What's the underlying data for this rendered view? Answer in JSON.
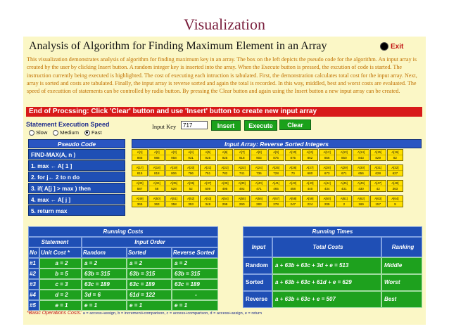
{
  "slide_title": "Visualization",
  "app": {
    "title": "Analysis of Algorithm for Finding Maximum Element in an Array",
    "exit_label": "Exit",
    "description": "This visualization demonstrates analysis of algorithm for finding maximum key in an array. The box on the left depicts the pseudo code for the algorithm. An input array is created by the user by clicking Insert button. A random integer key is inserted into the array. When the Execute button is pressed, the excution of code is started. The instruction currently being executed is highlighted. The cost of executing each intruction is tabulated. First, the demonstration calculates total cost for the input array. Next, array is sorted and costs are tabulated. Finally, the input array is reverse sorted and again the total is recorded. In this way, middled, best and worst costs are evaluated. The speed of executtion of statements can be controlled by radio button. By pressing the Clear button and again using the Insert button a new input array can be created.",
    "status_message": "End of Procssing: Click 'Clear' button and use 'Insert' button to create new input array"
  },
  "controls": {
    "speed_label": "Statement Execution Speed",
    "speed_options": [
      "Slow",
      "Medium",
      "Fast"
    ],
    "selected_speed": "Fast",
    "input_key_label": "Input Key",
    "input_key_value": "717",
    "insert_label": "Insert",
    "execute_label": "Execute",
    "clear_label": "Clear"
  },
  "pseudo_code": {
    "header": "Pseudo Code",
    "lines": [
      "FIND-MAX(A, n )",
      "1.  max ← A[ 1 ]",
      "2.  for j← 2 to n do",
      "3.      if( A[j ] > max ) then",
      "4.       max ← A[ j ]",
      "5.  return max"
    ]
  },
  "input_array": {
    "header": "Input Array: Reverse Sorted Integers",
    "rows": [
      {
        "indices": [
          "A[1]",
          "A[2]",
          "A[3]",
          "A[4]",
          "A[5]",
          "A[6]",
          "A[7]",
          "A[8]",
          "A[9]",
          "A[10]",
          "A[11]",
          "A[12]",
          "A[13]",
          "A[14]",
          "A[15]",
          "A[16]"
        ],
        "values": [
          "988",
          "988",
          "958",
          "931",
          "925",
          "925",
          "918",
          "903",
          "875",
          "875",
          "862",
          "856",
          "850",
          "843",
          "829",
          "82"
        ]
      },
      {
        "indices": [
          "A[17]",
          "A[18]",
          "A[19]",
          "A[20]",
          "A[21]",
          "A[22]",
          "A[23]",
          "A[24]",
          "A[25]",
          "A[26]",
          "A[27]",
          "A[28]",
          "A[29]",
          "A[30]",
          "A[31]",
          "A[32]"
        ],
        "values": [
          "815",
          "818",
          "806",
          "796",
          "751",
          "782",
          "741",
          "736",
          "728",
          "70",
          "680",
          "673",
          "671",
          "656",
          "628",
          "627"
        ]
      },
      {
        "indices": [
          "A[33]",
          "A[34]",
          "A[35]",
          "A[36]",
          "A[37]",
          "A[38]",
          "A[39]",
          "A[40]",
          "A[41]",
          "A[42]",
          "A[43]",
          "A[44]",
          "A[45]",
          "A[46]",
          "A[47]",
          "A[48]"
        ],
        "values": [
          "587",
          "58",
          "528",
          "52",
          "509",
          "495",
          "492",
          "471",
          "465",
          "458",
          "440",
          "434",
          "431",
          "430",
          "42",
          "363"
        ]
      },
      {
        "indices": [
          "A[49]",
          "A[50]",
          "A[51]",
          "A[52]",
          "A[53]",
          "A[54]",
          "A[55]",
          "A[56]",
          "A[57]",
          "A[58]",
          "A[59]",
          "A[60]",
          "A[61]",
          "A[62]",
          "A[63]",
          "A[64]"
        ],
        "values": [
          "365",
          "363",
          "358",
          "353",
          "348",
          "299",
          "290",
          "283",
          "278",
          "247",
          "224",
          "209",
          "2",
          "169",
          "157",
          "9"
        ]
      }
    ]
  },
  "running_costs": {
    "header": "Running Costs",
    "statement_label": "Statement",
    "input_order_label": "Input Order",
    "columns": [
      "No",
      "Unit Cost *",
      "Random",
      "Sorted",
      "Reverse Sorted"
    ],
    "rows": [
      [
        "#1",
        "a = 2",
        "a = 2",
        "a = 2",
        "a = 2"
      ],
      [
        "#2",
        "b = 5",
        "63b = 315",
        "63b = 315",
        "63b = 315"
      ],
      [
        "#3",
        "c = 3",
        "63c = 189",
        "63c = 189",
        "63c = 189"
      ],
      [
        "#4",
        "d = 2",
        "3d = 6",
        "61d = 122",
        "-"
      ],
      [
        "#5",
        "e = 1",
        "e = 1",
        "e = 1",
        "e = 1"
      ]
    ]
  },
  "running_times": {
    "header": "Running Times",
    "columns": [
      "Input",
      "Total Costs",
      "Ranking"
    ],
    "rows": [
      [
        "Random",
        "a + 63b + 63c + 3d + e = 513",
        "Middle"
      ],
      [
        "Sorted",
        "a + 63b + 63c + 61d + e = 629",
        "Worst"
      ],
      [
        "Reverse",
        "a + 63b + 63c + e = 507",
        "Best"
      ]
    ]
  },
  "footnote": {
    "label": "*Basic Operations Costs:",
    "items": "a = access+assign,  b = increment+comparison,  c = access+comparison,  d = access+assign,  e = return"
  },
  "colors": {
    "title_maroon": "#7a1f3d",
    "panel_bg": "#fbf7c6",
    "status_red": "#d81a1a",
    "header_blue": "#2a55c2",
    "cell_blue": "#1f4fb5",
    "cell_green": "#1ea11e",
    "array_yellow": "#ffe000"
  }
}
